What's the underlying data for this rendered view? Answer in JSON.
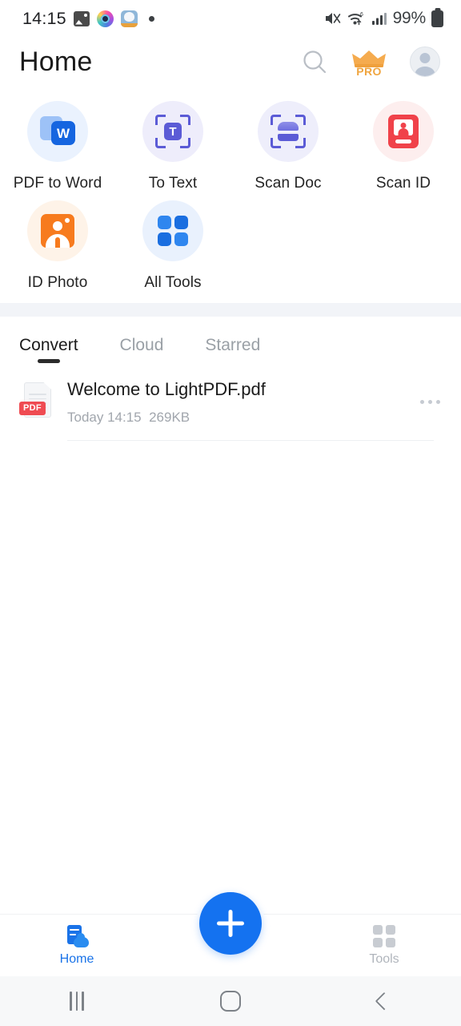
{
  "status_bar": {
    "time": "14:15",
    "battery_percent": "99%",
    "left_icons": [
      "gallery-icon",
      "camera-app-icon",
      "cat-app-icon",
      "notification-dot-icon"
    ],
    "right_icons": [
      "mute-icon",
      "wifi-icon",
      "signal-icon",
      "battery-icon"
    ]
  },
  "header": {
    "title": "Home",
    "search_icon": "search-icon",
    "pro_label": "PRO",
    "avatar_icon": "avatar-icon"
  },
  "tools": {
    "rows": [
      [
        {
          "label": "PDF to Word",
          "icon": "pdf-to-word-icon",
          "bubble": "#eaf2fe"
        },
        {
          "label": "To Text",
          "icon": "to-text-icon",
          "bubble": "#eeedfb"
        },
        {
          "label": "Scan Doc",
          "icon": "scan-doc-icon",
          "bubble": "#eeeefb"
        },
        {
          "label": "Scan ID",
          "icon": "scan-id-icon",
          "bubble": "#fdeeee"
        }
      ],
      [
        {
          "label": "ID Photo",
          "icon": "id-photo-icon",
          "bubble": "#fef3e8"
        },
        {
          "label": "All Tools",
          "icon": "all-tools-icon",
          "bubble": "#e9f1fd"
        }
      ]
    ],
    "glyphs": {
      "word_letter": "W",
      "text_letter": "T"
    }
  },
  "tabs": [
    {
      "label": "Convert",
      "active": true
    },
    {
      "label": "Cloud",
      "active": false
    },
    {
      "label": "Starred",
      "active": false
    }
  ],
  "files": [
    {
      "name": "Welcome to LightPDF.pdf",
      "date": "Today 14:15",
      "size": "269KB",
      "badge": "PDF",
      "more_icon": "more-options-icon"
    }
  ],
  "bottom_nav": {
    "home_label": "Home",
    "tools_label": "Tools",
    "home_icon": "home-cloud-icon",
    "tools_icon": "tools-grid-icon",
    "fab_icon": "plus-icon"
  },
  "android_nav": {
    "recents": "recents-icon",
    "home": "home-icon",
    "back": "back-icon"
  },
  "colors": {
    "accent": "#1a73e8",
    "pro": "#f0a53f",
    "red": "#ef4b52",
    "orange": "#f77b1e",
    "purple": "#5b5bd6"
  }
}
